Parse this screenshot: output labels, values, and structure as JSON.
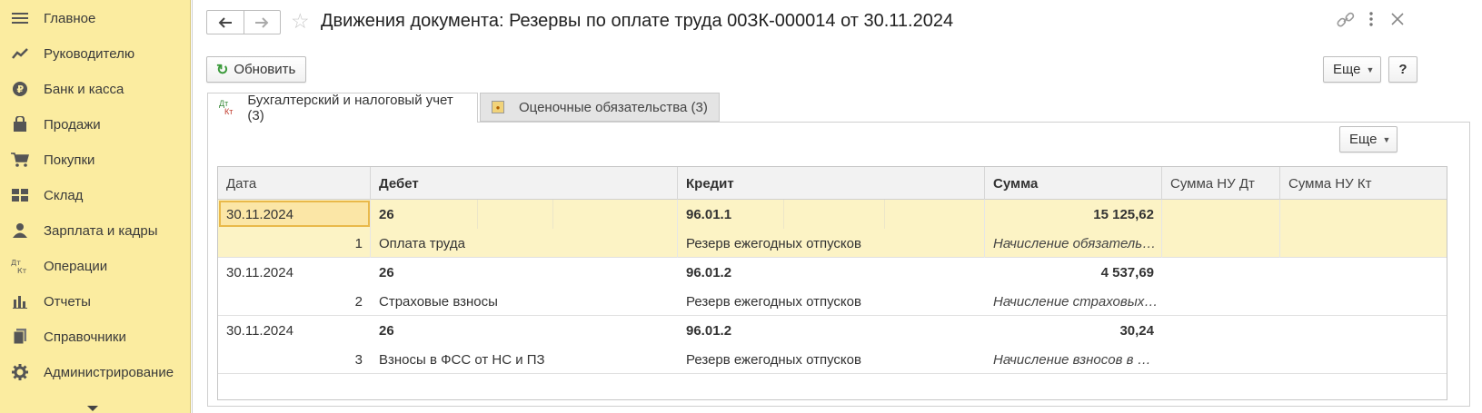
{
  "sidebar": {
    "items": [
      {
        "label": "Главное",
        "icon": "menu-lines-icon"
      },
      {
        "label": "Руководителю",
        "icon": "trend-icon"
      },
      {
        "label": "Банк и касса",
        "icon": "coin-icon"
      },
      {
        "label": "Продажи",
        "icon": "bag-icon"
      },
      {
        "label": "Покупки",
        "icon": "cart-icon"
      },
      {
        "label": "Склад",
        "icon": "warehouse-icon"
      },
      {
        "label": "Зарплата и кадры",
        "icon": "person-icon"
      },
      {
        "label": "Операции",
        "icon": "dt-kt-icon"
      },
      {
        "label": "Отчеты",
        "icon": "bar-chart-icon"
      },
      {
        "label": "Справочники",
        "icon": "books-icon"
      },
      {
        "label": "Администрирование",
        "icon": "gear-icon"
      }
    ]
  },
  "header": {
    "title": "Движения документа: Резервы по оплате труда 00ЗК-000014 от 30.11.2024"
  },
  "toolbar": {
    "refresh_label": "Обновить",
    "more_label": "Еще",
    "help_label": "?"
  },
  "tabs": [
    {
      "label": "Бухгалтерский и налоговый учет (3)",
      "icon_dt": "Дт",
      "icon_kt": "Кт"
    },
    {
      "label": "Оценочные обязательства (3)"
    }
  ],
  "table": {
    "more_label": "Еще",
    "columns": [
      "Дата",
      "Дебет",
      "Кредит",
      "Сумма",
      "Сумма НУ Дт",
      "Сумма НУ Кт"
    ],
    "rows": [
      {
        "date": "30.11.2024",
        "num": "1",
        "debit": "26",
        "debit_desc": "Оплата труда",
        "credit": "96.01.1",
        "credit_desc": "Резерв ежегодных отпусков",
        "sum": "15 125,62",
        "content": "Начисление обязатель…"
      },
      {
        "date": "30.11.2024",
        "num": "2",
        "debit": "26",
        "debit_desc": "Страховые взносы",
        "credit": "96.01.2",
        "credit_desc": "Резерв ежегодных отпусков",
        "sum": "4 537,69",
        "content": "Начисление страховых…"
      },
      {
        "date": "30.11.2024",
        "num": "3",
        "debit": "26",
        "debit_desc": "Взносы в ФСС от НС и ПЗ",
        "credit": "96.01.2",
        "credit_desc": "Резерв ежегодных отпусков",
        "sum": "30,24",
        "content": "Начисление взносов в …"
      }
    ]
  }
}
